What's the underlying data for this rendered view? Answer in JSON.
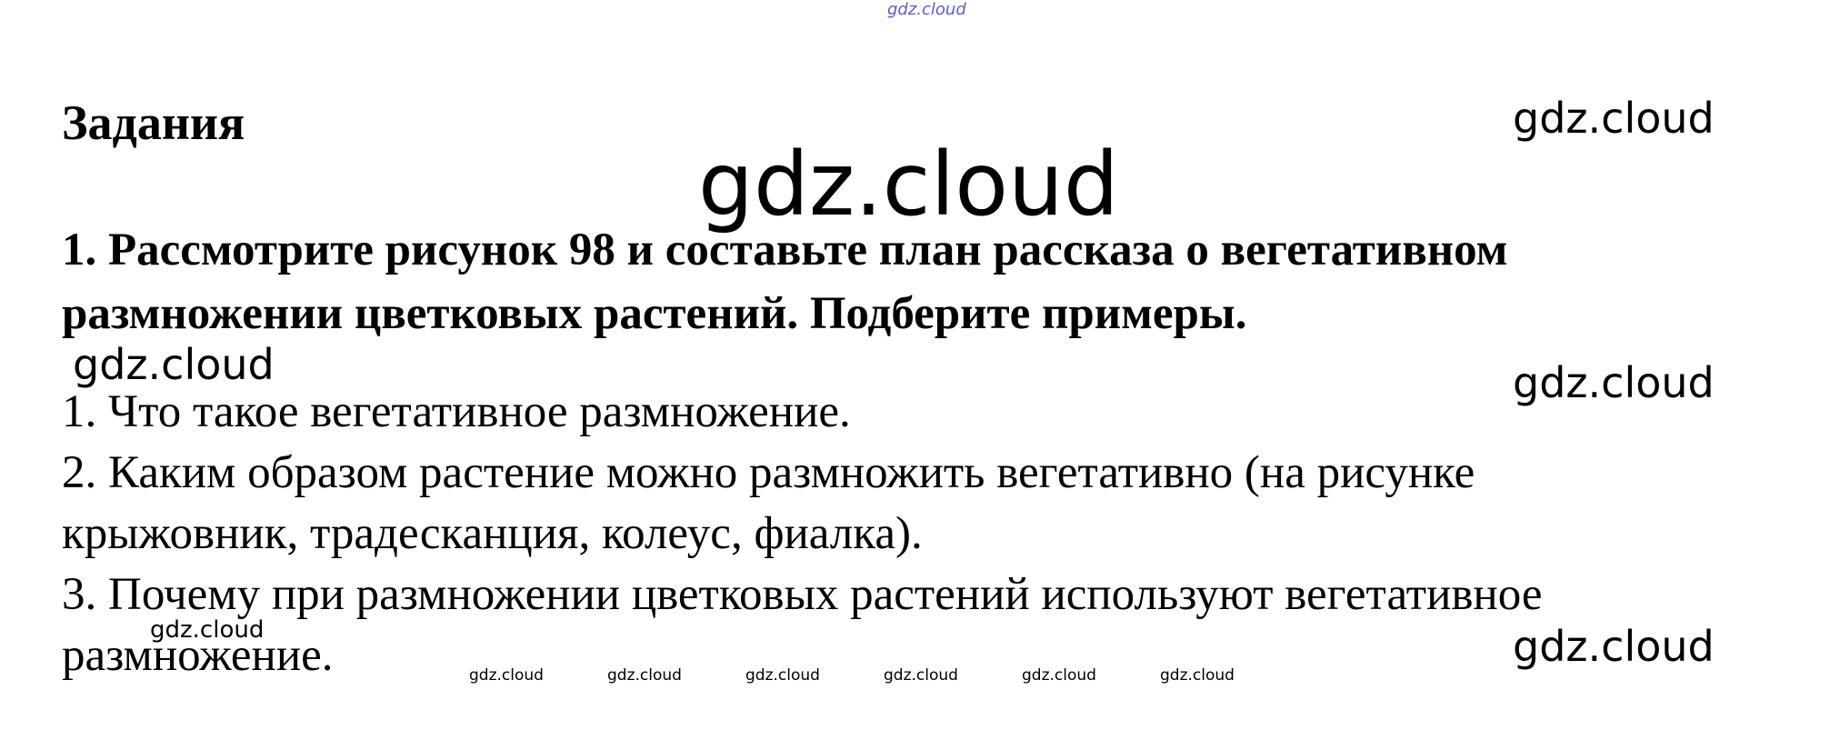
{
  "watermarks": {
    "top": "gdz.cloud",
    "center": "gdz.cloud",
    "right_1": "gdz.cloud",
    "right_2": "gdz.cloud",
    "right_3": "gdz.cloud",
    "left_1": "gdz.cloud",
    "left_2": "gdz.cloud",
    "bottom_row": [
      "gdz.cloud",
      "gdz.cloud",
      "gdz.cloud",
      "gdz.cloud",
      "gdz.cloud",
      "gdz.cloud"
    ]
  },
  "heading": "Задания",
  "task": {
    "line_1": "1. Рассмотрите рисунок 98 и составьте план рассказа о вегетативном",
    "line_2": "размножении цветковых растений. Подберите примеры."
  },
  "questions": {
    "line_1": "1. Что такое вегетативное размножение.",
    "line_2": "2. Каким образом растение можно размножить вегетативно (на рисунке",
    "line_3": "крыжовник, традесканция, колеус, фиалка).",
    "line_4": "3. Почему при размножении цветковых растений используют вегетативное",
    "line_5": "размножение."
  }
}
